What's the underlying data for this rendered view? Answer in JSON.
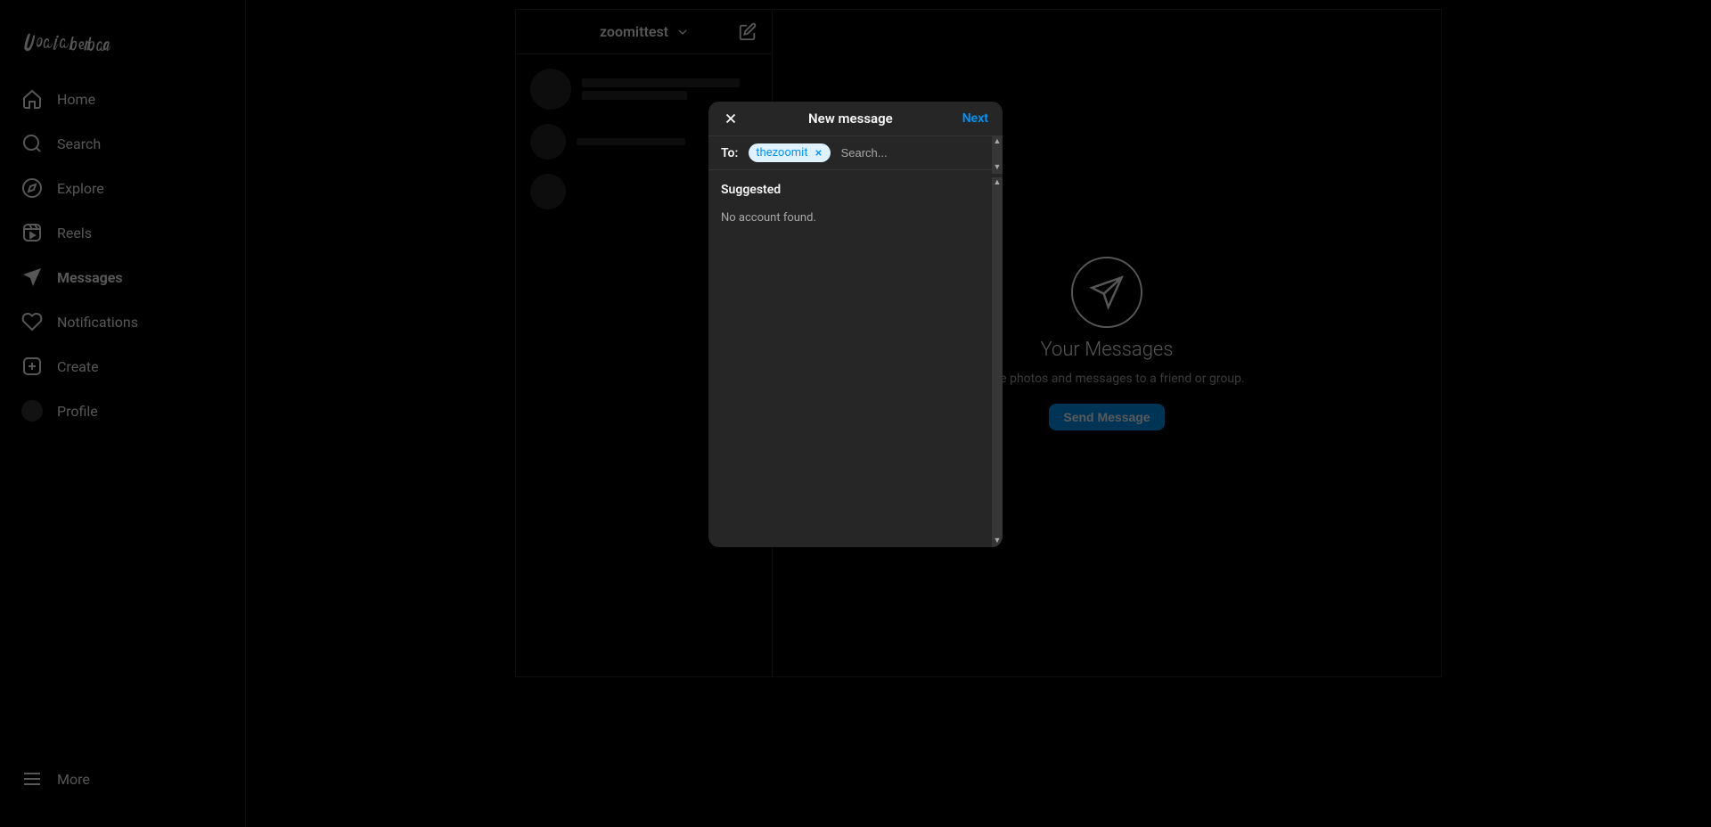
{
  "brand": "Instagram",
  "sidebar": {
    "items": [
      {
        "label": "Home",
        "icon": "home"
      },
      {
        "label": "Search",
        "icon": "search"
      },
      {
        "label": "Explore",
        "icon": "compass"
      },
      {
        "label": "Reels",
        "icon": "reels"
      },
      {
        "label": "Messages",
        "icon": "send",
        "active": true
      },
      {
        "label": "Notifications",
        "icon": "heart"
      },
      {
        "label": "Create",
        "icon": "plus"
      },
      {
        "label": "Profile",
        "icon": "avatar"
      }
    ],
    "more_label": "More"
  },
  "threads": {
    "account": "zoomittest"
  },
  "empty_conversation": {
    "title": "Your Messages",
    "subtitle": "private photos and messages to a friend or group.",
    "button": "Send Message"
  },
  "modal": {
    "title": "New message",
    "next": "Next",
    "to_label": "To:",
    "chip": "thezoomit",
    "search_placeholder": "Search...",
    "suggested_title": "Suggested",
    "no_account": "No account found."
  }
}
